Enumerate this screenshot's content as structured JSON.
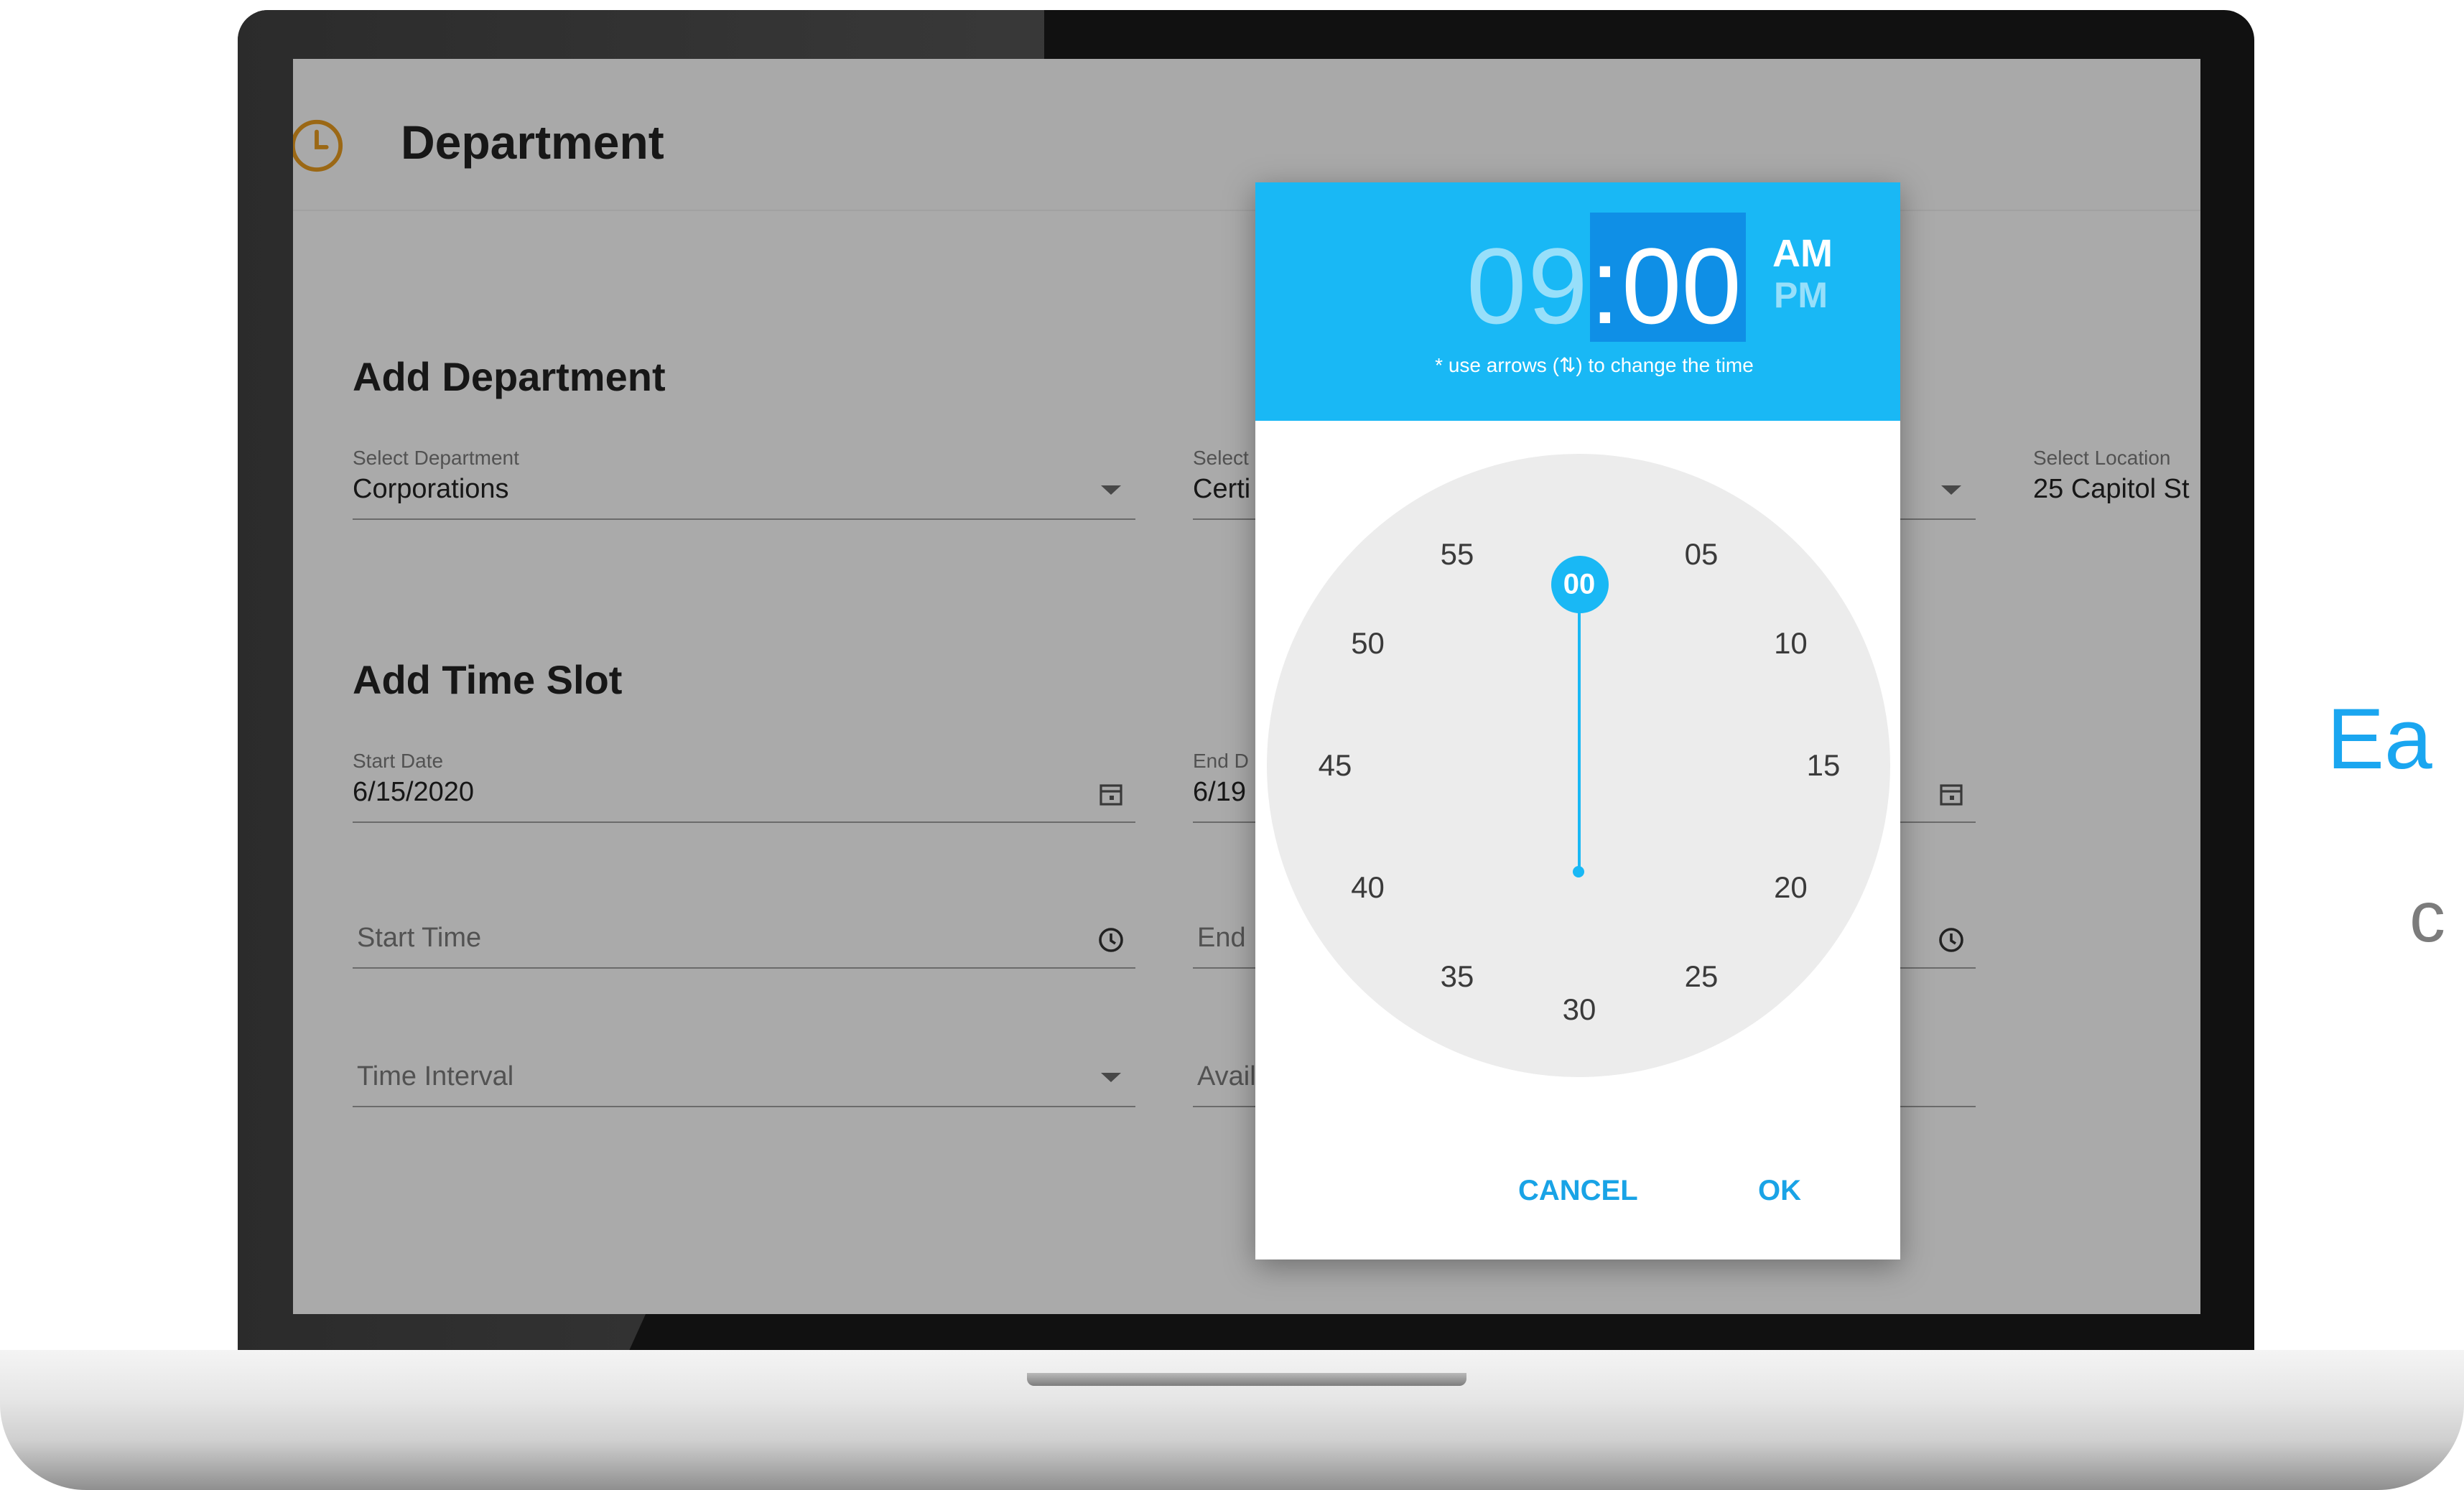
{
  "app": {
    "page_title": "Department",
    "add_department_title": "Add Department",
    "add_time_slot_title": "Add Time Slot"
  },
  "department_form": {
    "select_department": {
      "label": "Select Department",
      "value": "Corporations"
    },
    "select_service": {
      "label": "Select",
      "value": "Certi"
    },
    "select_location": {
      "label": "Select Location",
      "value": "25 Capitol St"
    }
  },
  "time_slot_form": {
    "start_date": {
      "label": "Start Date",
      "value": "6/15/2020"
    },
    "end_date": {
      "label": "End D",
      "value": "6/19"
    },
    "start_time": {
      "placeholder": "Start Time"
    },
    "end_time": {
      "placeholder": "End"
    },
    "time_interval": {
      "placeholder": "Time Interval"
    },
    "availability": {
      "placeholder": "Avail"
    }
  },
  "time_picker": {
    "hour": "09",
    "colon": ":",
    "minute": "00",
    "am": "AM",
    "pm": "PM",
    "hint": "* use arrows (⇅) to change the time",
    "minutes": [
      "00",
      "05",
      "10",
      "15",
      "20",
      "25",
      "30",
      "35",
      "40",
      "45",
      "50",
      "55"
    ],
    "selected_minute": "00",
    "cancel_label": "CANCEL",
    "ok_label": "OK"
  },
  "marketing": {
    "line1": "Ea",
    "line2": "c"
  },
  "colors": {
    "accent": "#19b8f5",
    "selected": "#0f8fe6",
    "clock_face": "#ececec"
  }
}
